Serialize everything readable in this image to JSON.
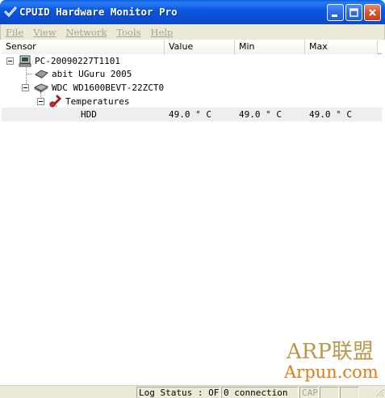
{
  "window": {
    "title": "CPUID Hardware Monitor Pro",
    "accent_color": "#0a4fd4",
    "close_color": "#d9552f"
  },
  "icons": {
    "app": "checkmark-app-icon",
    "minimize": "minimize-icon",
    "maximize": "maximize-icon",
    "close": "close-icon",
    "computer": "computer-icon",
    "chip": "chip-icon",
    "harddisk": "harddisk-icon",
    "thermometer": "thermometer-icon"
  },
  "menu": {
    "items": [
      "File",
      "View",
      "Network",
      "Tools",
      "Help"
    ]
  },
  "columns": {
    "sensor": "Sensor",
    "value": "Value",
    "min": "Min",
    "max": "Max"
  },
  "tree": {
    "computer": {
      "label": "PC-20090227T1101"
    },
    "device1": {
      "label": "abit UGuru 2005"
    },
    "device2": {
      "label": "WDC WD1600BEVT-22ZCT0"
    },
    "group": {
      "label": "Temperatures"
    },
    "sensor": {
      "label": "HDD",
      "value": "49.0 ° C",
      "min": "49.0 ° C",
      "max": "49.0 ° C"
    }
  },
  "watermark": {
    "line1": "ARP联盟",
    "line2": "Arpun.com"
  },
  "status": {
    "log": "Log Status : OFF",
    "connection": "0 connection",
    "cap": "CAP"
  }
}
